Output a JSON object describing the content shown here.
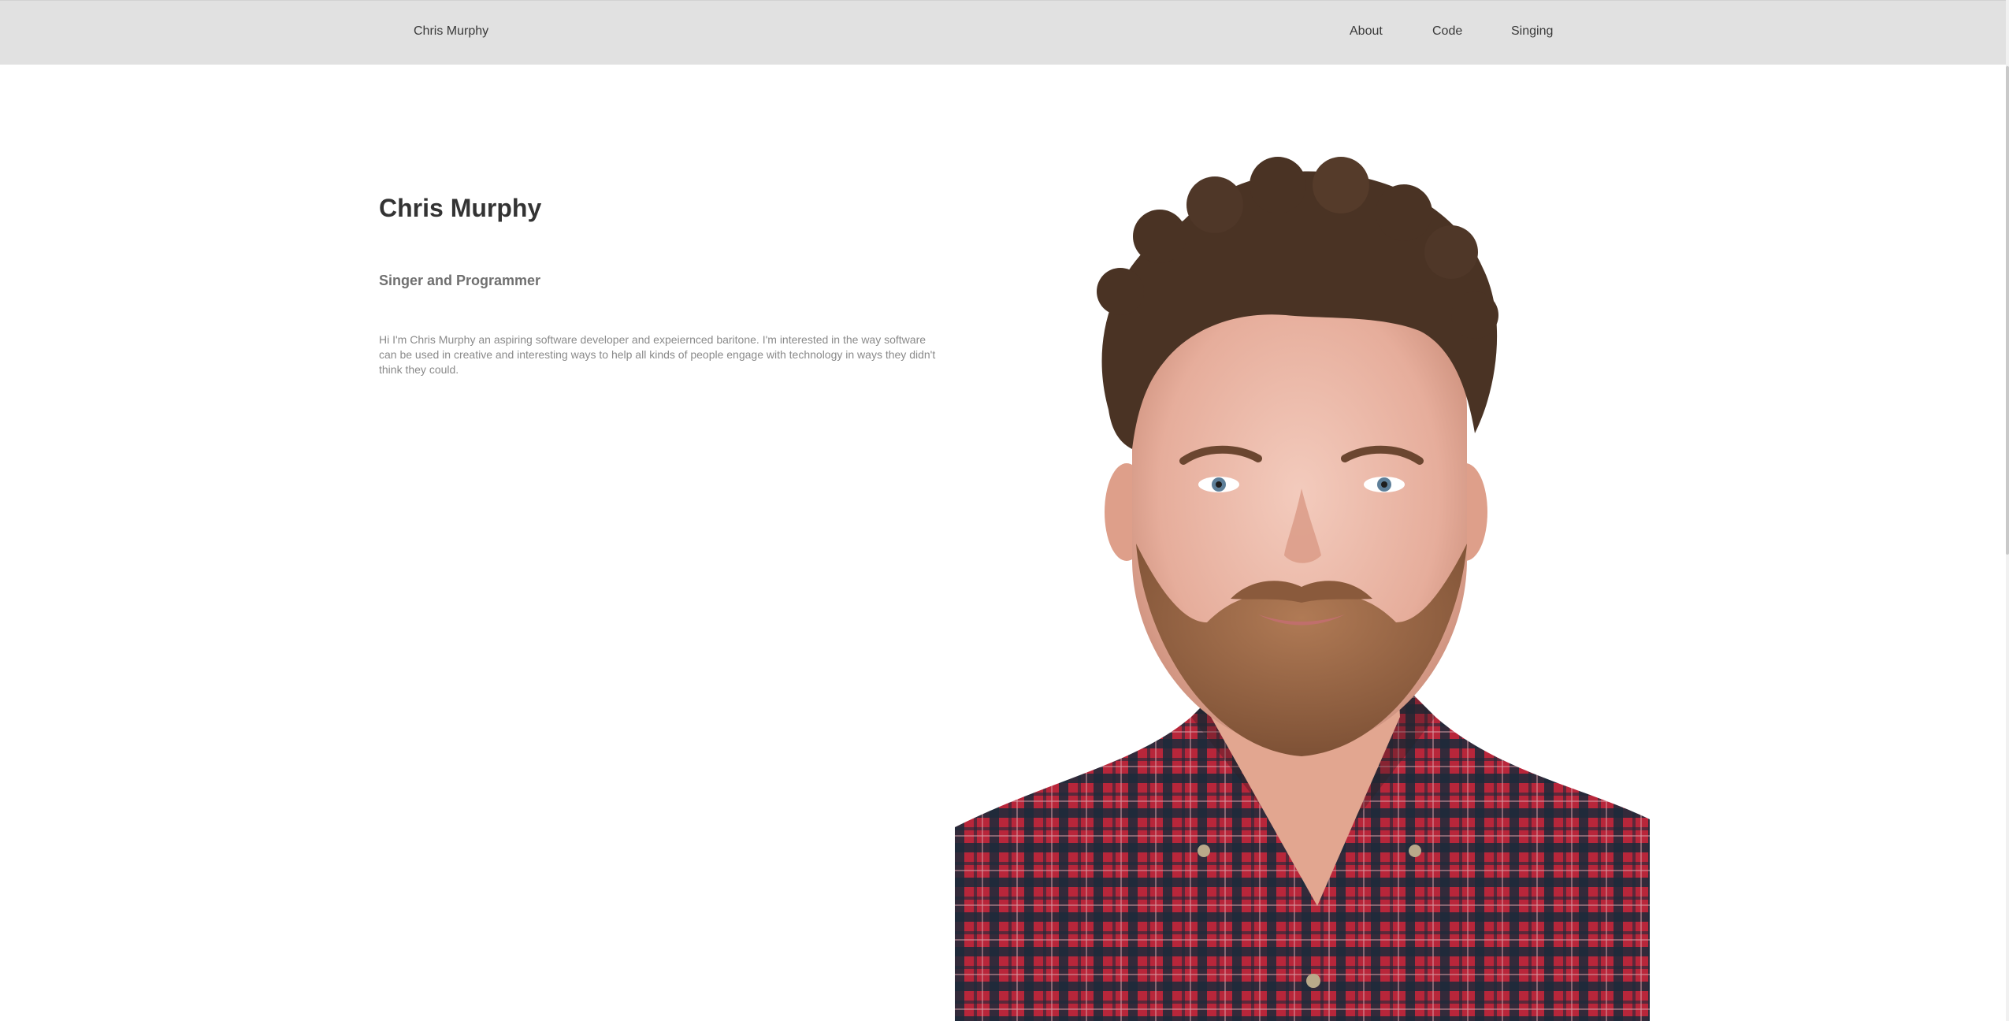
{
  "navbar": {
    "brand": "Chris Murphy",
    "links": [
      {
        "label": "About"
      },
      {
        "label": "Code"
      },
      {
        "label": "Singing"
      }
    ],
    "background": "#e1e1e1"
  },
  "hero": {
    "name": "Chris Murphy",
    "subtitle": "Singer and Programmer",
    "bio": "Hi I'm Chris Murphy an aspiring software developer and expeiernced baritone. I'm interested in the way software can be used in creative and interesting ways to help all kinds of people engage with technology in ways they didn't think they could.",
    "portrait": {
      "subject": "portrait-photo",
      "shirt_colors": [
        "#b8263a",
        "#1c2a3a"
      ],
      "hair_color": "#4a3324",
      "skin_color": "#e9b9a8"
    }
  }
}
